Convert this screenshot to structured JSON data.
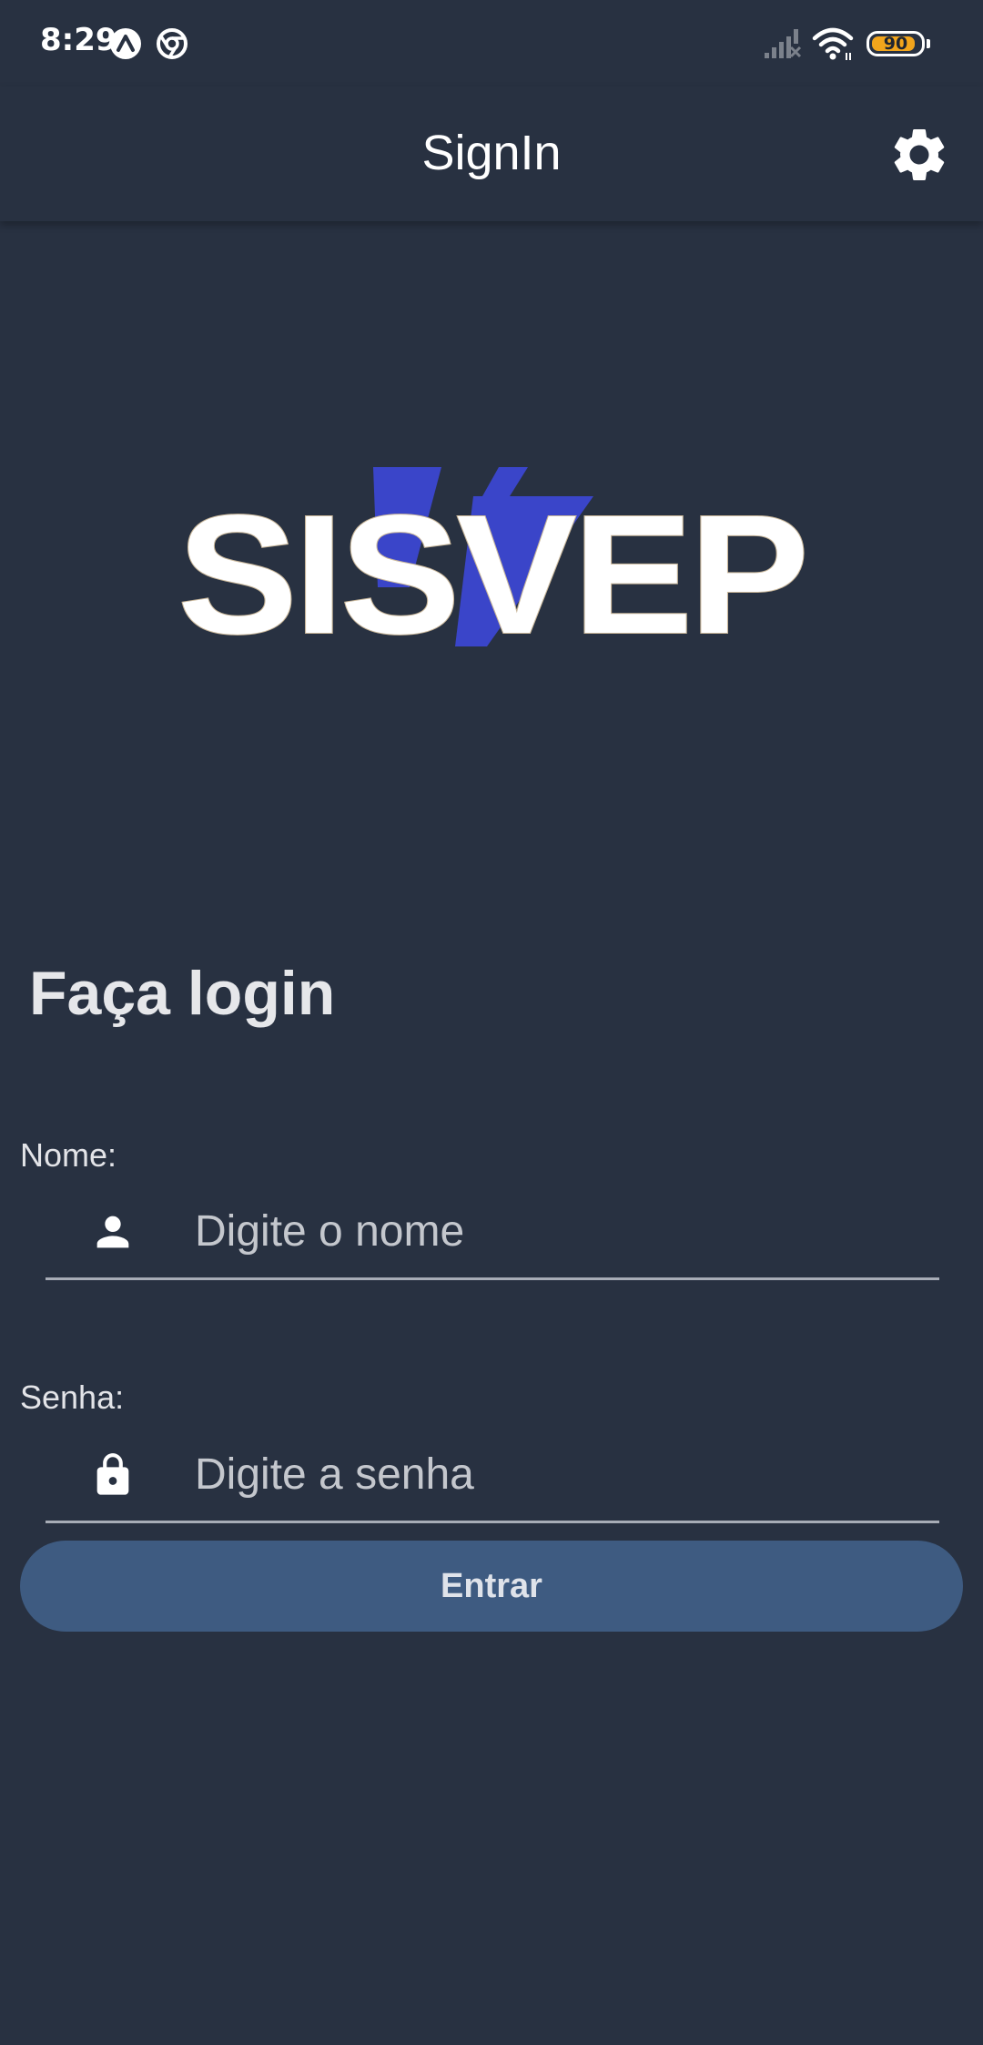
{
  "status_bar": {
    "time": "8:29",
    "battery_level": "90",
    "battery_fraction": 0.9,
    "icons": [
      "a-notification-icon",
      "chrome-icon",
      "signal-icon",
      "wifi-icon",
      "battery-icon"
    ]
  },
  "app_bar": {
    "title": "SignIn",
    "settings_icon": "gear-icon"
  },
  "logo": {
    "text": "SISVEP",
    "colors": {
      "letters": "#ffffff",
      "accent": "#3a45c9"
    }
  },
  "form": {
    "heading": "Faça login",
    "name": {
      "label": "Nome:",
      "placeholder": "Digite o nome",
      "icon": "person-icon",
      "value": ""
    },
    "password": {
      "label": "Senha:",
      "placeholder": "Digite a senha",
      "icon": "lock-icon",
      "value": ""
    },
    "submit_label": "Entrar"
  },
  "colors": {
    "background": "#283141",
    "button": "#3e5b81",
    "input_underline": "#a7acb6",
    "battery": "#f2a51c"
  }
}
